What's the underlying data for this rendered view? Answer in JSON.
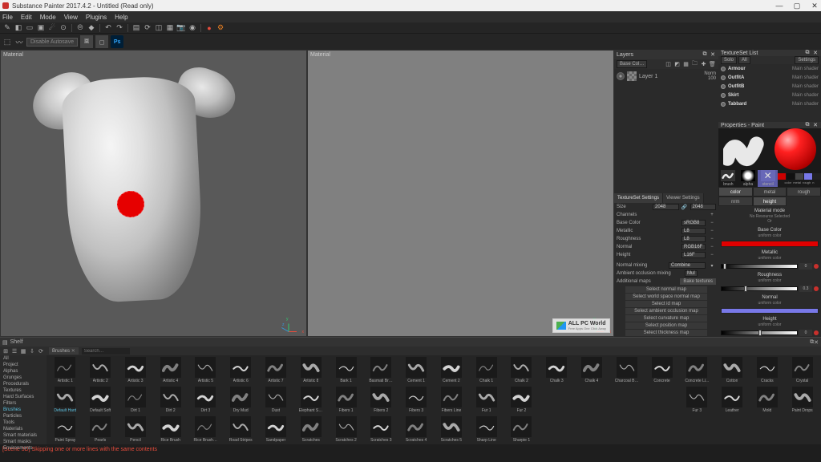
{
  "titlebar": {
    "title": "Substance Painter 2017.4.2 - Untitled (Read only)",
    "min": "—",
    "max": "▢",
    "close": "✕"
  },
  "menu": {
    "items": [
      "File",
      "Edit",
      "Mode",
      "View",
      "Plugins",
      "Help"
    ]
  },
  "toolbar2": {
    "autosave": "Disable Autosave"
  },
  "viewport": {
    "left_label": "Material",
    "right_label": "Material"
  },
  "watermark": {
    "line1": "ALL PC World",
    "line2": "Free Apps One Click Away"
  },
  "layers": {
    "title": "Layers",
    "mode": "Base Col…",
    "layer_name": "Layer 1",
    "blend": "Norm",
    "opacity": "100"
  },
  "textureset_list": {
    "title": "TextureSet List",
    "solo": "Solo",
    "all": "All",
    "settings": "Settings",
    "items": [
      {
        "name": "Armour",
        "shader": "Main shader"
      },
      {
        "name": "OutfitA",
        "shader": "Main shader"
      },
      {
        "name": "OutfitB",
        "shader": "Main shader"
      },
      {
        "name": "Skirt",
        "shader": "Main shader"
      },
      {
        "name": "Tabbard",
        "shader": "Main shader"
      }
    ]
  },
  "properties": {
    "title": "Properties - Paint",
    "bas": {
      "brush": "brush",
      "alpha": "alpha",
      "stencil": "stencil"
    },
    "slots": {
      "color": "color",
      "metal": "metal",
      "rough": "rough",
      "n": "n"
    },
    "tabs": {
      "color": "color",
      "metal": "metal",
      "rough": "rough",
      "nrm": "nrm",
      "height": "height"
    },
    "material_mode": "Material mode",
    "no_res": "No Resource Selected",
    "or": "Or",
    "base_color": "Base Color",
    "uniform": "uniform color",
    "metallic": "Metallic",
    "roughness": "Roughness",
    "normal": "Normal",
    "height": "Height",
    "vals": {
      "metal": "0",
      "rough": "0.3",
      "height": "0"
    }
  },
  "tss": {
    "tab1": "TextureSet Settings",
    "tab2": "Viewer Settings",
    "size": "Size",
    "size_val": "2048",
    "size_lock": "2048",
    "channels": "Channels",
    "rows": [
      {
        "label": "Base Color",
        "fmt": "sRGB8"
      },
      {
        "label": "Metallic",
        "fmt": "L8"
      },
      {
        "label": "Roughness",
        "fmt": "L8"
      },
      {
        "label": "Normal",
        "fmt": "RGB16F"
      },
      {
        "label": "Height",
        "fmt": "L16F"
      }
    ],
    "normal_mixing": "Normal mixing",
    "combine": "Combine",
    "ao_mixing": "Ambient occlusion mixing",
    "ao_mode": "Mul",
    "additional": "Additional maps",
    "bake": "Bake textures",
    "maps": [
      "Select normal map",
      "Select world space normal map",
      "Select id map",
      "Select ambient occlusion map",
      "Select curvature map",
      "Select position map",
      "Select thickness map"
    ]
  },
  "shelf": {
    "title": "Shelf",
    "categories": [
      "All",
      "Project",
      "Alphas",
      "Grunges",
      "Procedurals",
      "Textures",
      "Hard Surfaces",
      "Filters",
      "Brushes",
      "Particles",
      "Tools",
      "Materials",
      "Smart materials",
      "Smart masks",
      "Environments"
    ],
    "active_cat": "Brushes",
    "tab": "Brushes",
    "tab_close": "✕",
    "search_placeholder": "Search…",
    "brushes": [
      "Artistic 1",
      "Artistic 2",
      "Artistic 3",
      "Artistic 4",
      "Artistic 5",
      "Artistic 6",
      "Artistic 7",
      "Artistic 8",
      "Bark 1",
      "Basmati Brush",
      "Cement 1",
      "Cement 2",
      "Chalk 1",
      "Chalk 2",
      "Chalk 3",
      "Chalk 4",
      "Charcoal Br...",
      "Concrete",
      "Concrete Li...",
      "Cotton",
      "Cracks",
      "Crystal",
      "Default Hard",
      "Default Soft",
      "Dirt 1",
      "Dirt 2",
      "Dirt 3",
      "Dry Mud",
      "Dust",
      "Elephant Skin",
      "Fibers 1",
      "Fibers 2",
      "Fibers 3",
      "Fibers Line",
      "Fur 1",
      "Fur 2",
      "",
      "",
      "",
      "",
      "Fur 3",
      "Leather",
      "Mold",
      "Paint Drops",
      "Paint Spray",
      "Pearls",
      "Pencil",
      "Rice Brush",
      "Rice Brush L...",
      "Road Stripes",
      "Sandpaper",
      "Scratches",
      "Scratches 2",
      "Scratches 3",
      "Scratches 4",
      "Scratches 5",
      "Sharp Line",
      "Sharpie 1",
      "",
      ""
    ],
    "selected": "Default Hard"
  },
  "status": {
    "text": "[Scene 3D] Skipping one or more lines with the same contents"
  }
}
